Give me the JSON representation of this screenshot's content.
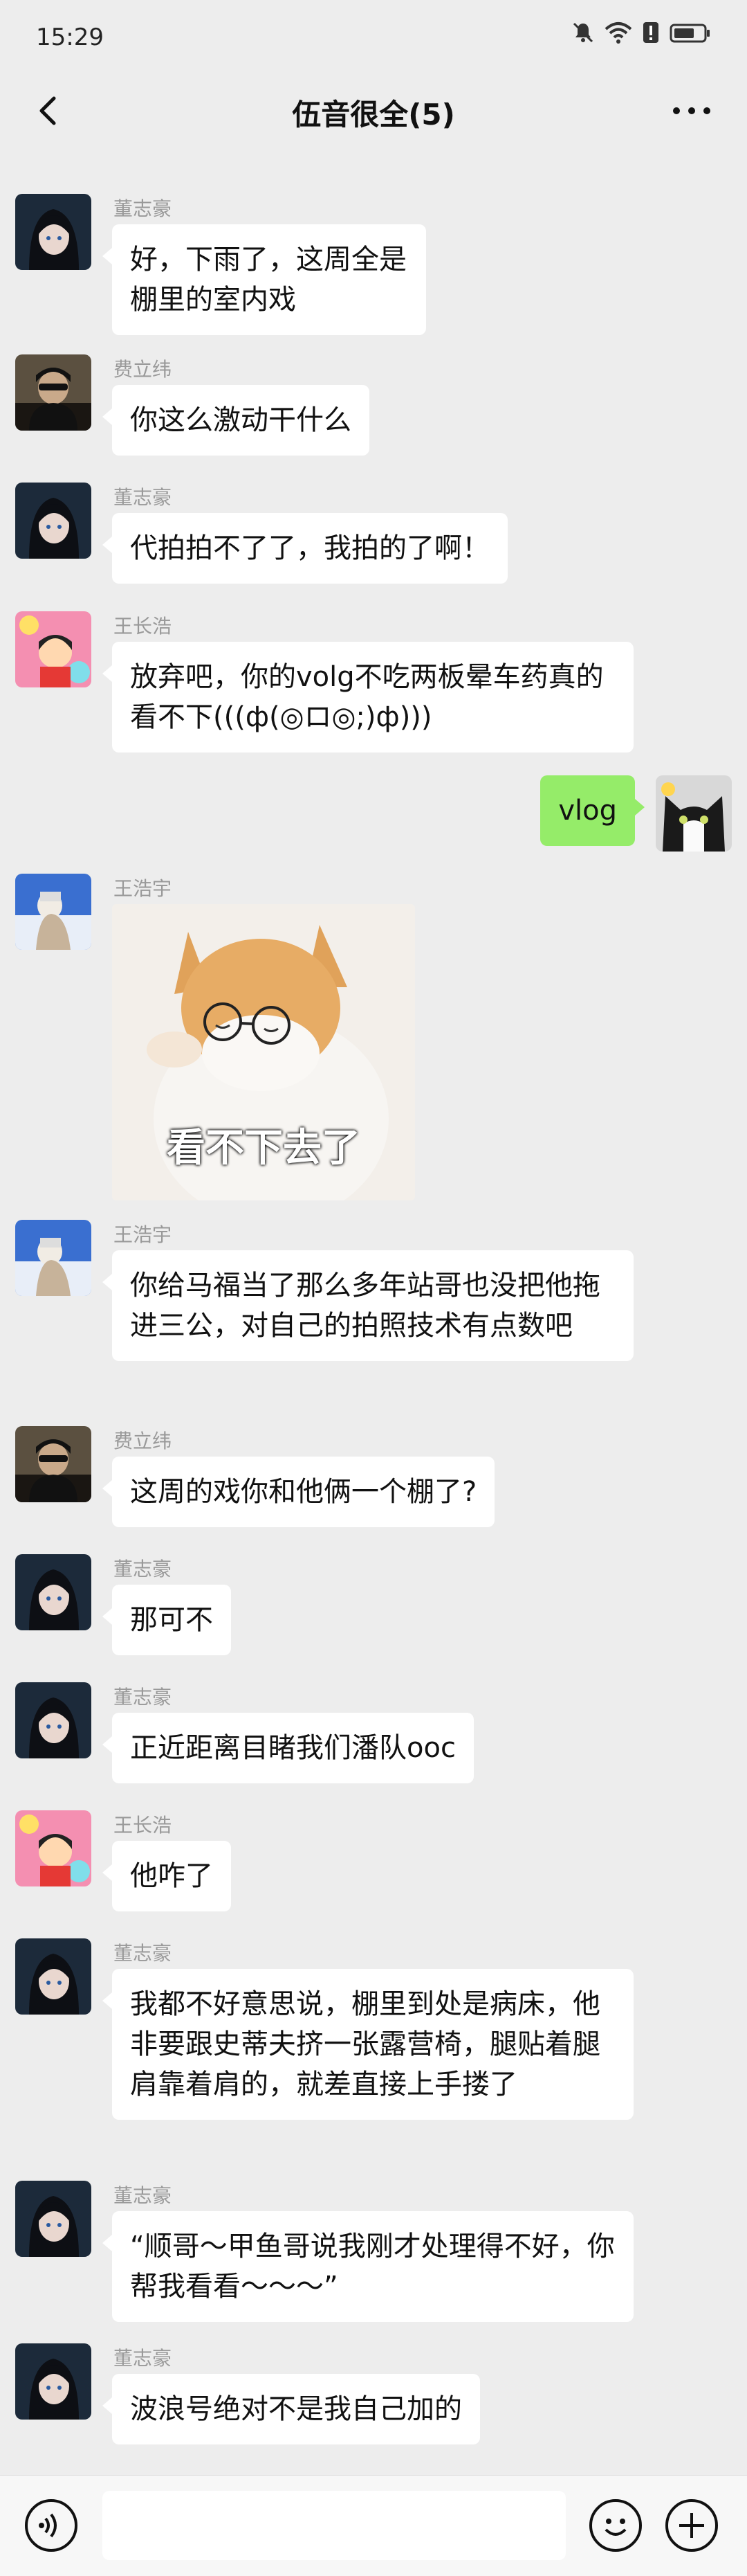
{
  "status_bar": {
    "time": "15:29",
    "icons": [
      "mute-icon",
      "wifi-icon",
      "alert-icon",
      "battery-icon"
    ]
  },
  "header": {
    "title": "伍音很全(5)",
    "back_icon": "chevron-left-icon",
    "more_icon": "more-dots-icon"
  },
  "messages": [
    {
      "sender": "董志豪",
      "text": "好，下雨了，这周全是棚里的室内戏",
      "side": "left"
    },
    {
      "sender": "费立纬",
      "text": "你这么激动干什么",
      "side": "left"
    },
    {
      "sender": "董志豪",
      "text": "代拍拍不了了，我拍的了啊！",
      "side": "left"
    },
    {
      "sender": "王长浩",
      "text": "放弃吧，你的volg不吃两板晕车药真的看不下(((ф(◎ロ◎;)ф)))",
      "side": "left"
    },
    {
      "sender": "",
      "text": "vlog",
      "side": "right"
    },
    {
      "sender": "王浩宇",
      "text": "看不下去了",
      "side": "left",
      "type": "sticker"
    },
    {
      "sender": "王浩宇",
      "text": "你给马福当了那么多年站哥也没把他拖进三公，对自己的拍照技术有点数吧",
      "side": "left"
    },
    {
      "sender": "费立纬",
      "text": "这周的戏你和他俩一个棚了?",
      "side": "left"
    },
    {
      "sender": "董志豪",
      "text": "那可不",
      "side": "left"
    },
    {
      "sender": "董志豪",
      "text": "正近距离目睹我们潘队ooc",
      "side": "left"
    },
    {
      "sender": "王长浩",
      "text": "他咋了",
      "side": "left"
    },
    {
      "sender": "董志豪",
      "text": "我都不好意思说，棚里到处是病床，他非要跟史蒂夫挤一张露营椅，腿贴着腿肩靠着肩的，就差直接上手搂了",
      "side": "left"
    },
    {
      "sender": "董志豪",
      "text": "“顺哥～甲鱼哥说我刚才处理得不好，你帮我看看～～～”",
      "side": "left"
    },
    {
      "sender": "董志豪",
      "text": "波浪号绝对不是我自己加的",
      "side": "left"
    }
  ],
  "input_bar": {
    "voice_icon": "voice-icon",
    "emoji_icon": "emoji-icon",
    "plus_icon": "plus-icon"
  },
  "colors": {
    "background": "#ededed",
    "bubble_left": "#ffffff",
    "bubble_right": "#95ec69"
  }
}
